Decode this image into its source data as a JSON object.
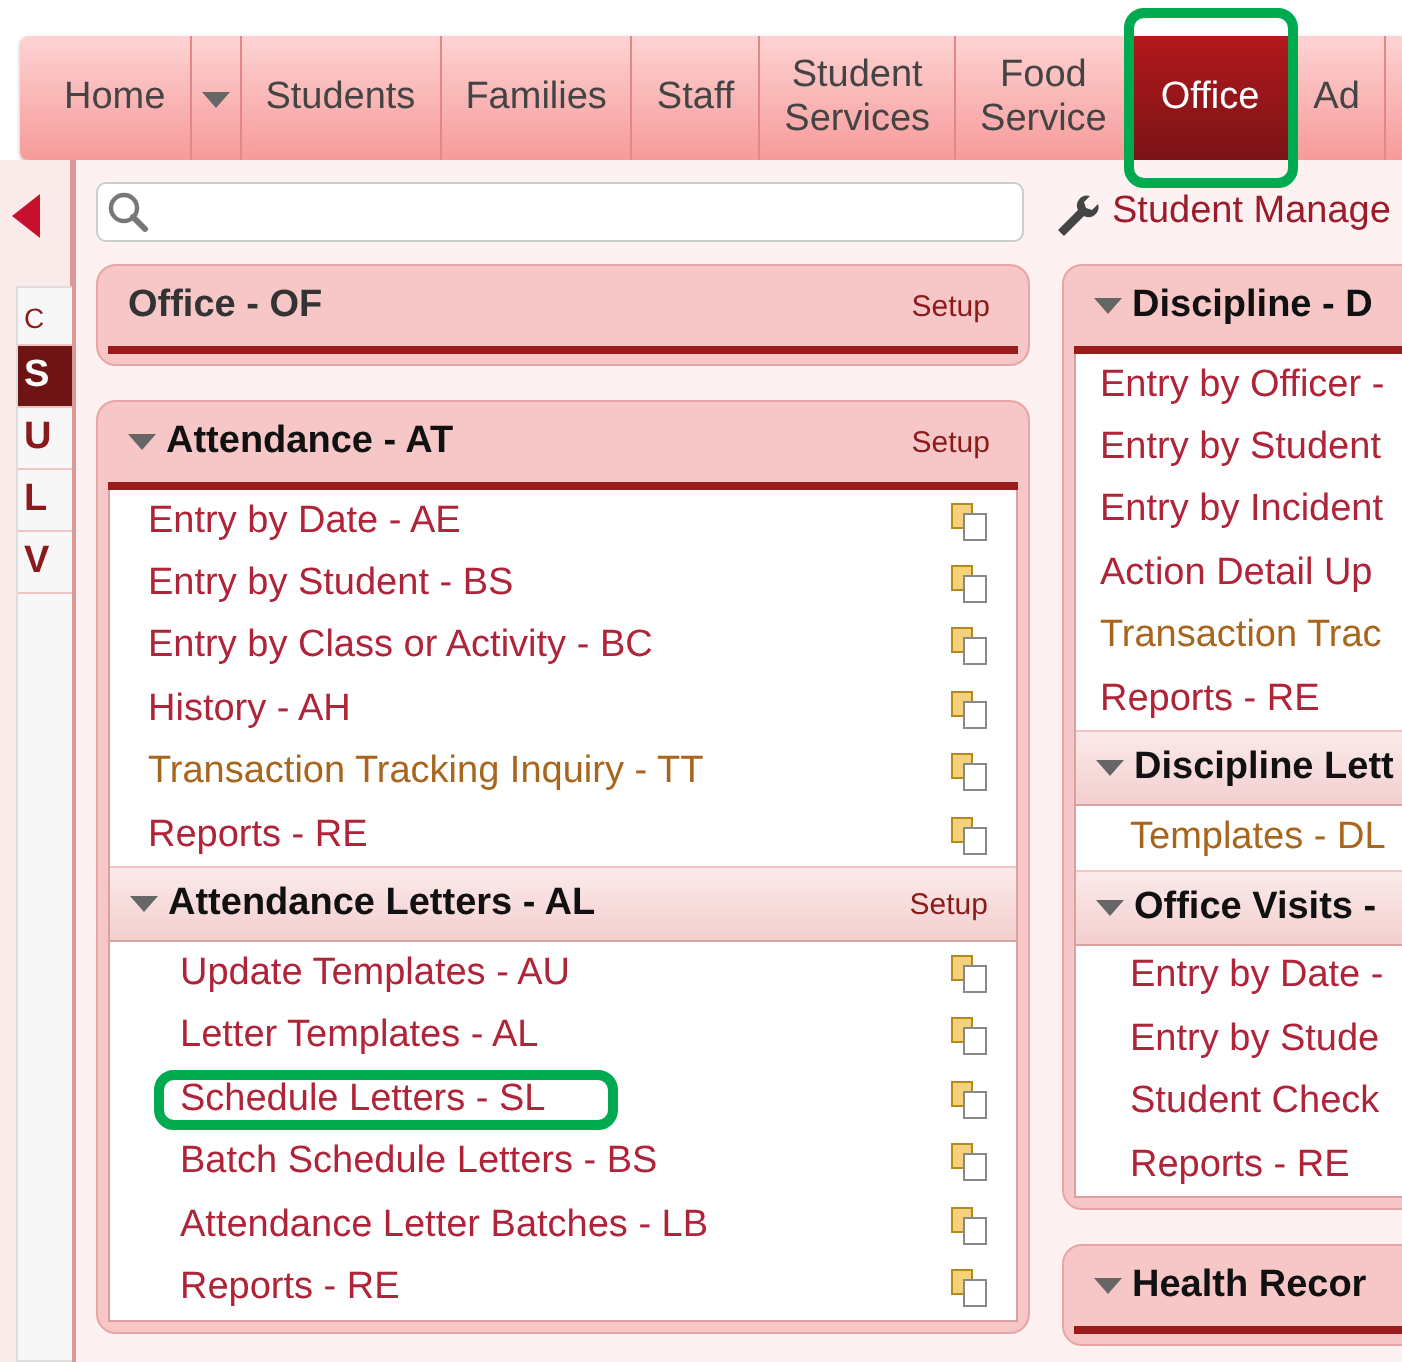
{
  "nav_tabs": [
    {
      "label": "Home",
      "selected": false,
      "highlighted": false
    },
    {
      "label": "Students",
      "selected": false,
      "highlighted": false
    },
    {
      "label": "Families",
      "selected": false,
      "highlighted": false
    },
    {
      "label": "Staff",
      "selected": false,
      "highlighted": false
    },
    {
      "label": "Student Services",
      "selected": false,
      "highlighted": false
    },
    {
      "label": "Food Service",
      "selected": false,
      "highlighted": false
    },
    {
      "label": "Office",
      "selected": true,
      "highlighted": true
    },
    {
      "label": "Ad",
      "selected": false,
      "highlighted": false
    }
  ],
  "sidebar": {
    "items": [
      {
        "label": "C",
        "selected": false
      },
      {
        "label": "S",
        "selected": true
      },
      {
        "label": "U",
        "selected": false
      },
      {
        "label": "L",
        "selected": false
      },
      {
        "label": "V",
        "selected": false
      }
    ]
  },
  "toolbar_link": "Student Manage",
  "columns": [
    {
      "cards": [
        {
          "title": "Office - OF",
          "setup": "Setup",
          "expandable": false
        },
        {
          "title": "Attendance - AT",
          "setup": "Setup",
          "expandable": true,
          "items": [
            {
              "label": "Entry by Date - AE",
              "visited": false,
              "highlighted": false
            },
            {
              "label": "Entry by Student - BS",
              "visited": false,
              "highlighted": false
            },
            {
              "label": "Entry by Class or Activity - BC",
              "visited": false,
              "highlighted": false
            },
            {
              "label": "History - AH",
              "visited": false,
              "highlighted": false
            },
            {
              "label": "Transaction Tracking Inquiry - TT",
              "visited": true,
              "highlighted": false
            },
            {
              "label": "Reports - RE",
              "visited": false,
              "highlighted": false
            }
          ],
          "subsections": [
            {
              "title": "Attendance Letters - AL",
              "setup": "Setup",
              "items": [
                {
                  "label": "Update Templates - AU",
                  "visited": false,
                  "highlighted": false
                },
                {
                  "label": "Letter Templates - AL",
                  "visited": false,
                  "highlighted": false
                },
                {
                  "label": "Schedule Letters - SL",
                  "visited": false,
                  "highlighted": true
                },
                {
                  "label": "Batch Schedule Letters - BS",
                  "visited": false,
                  "highlighted": false
                },
                {
                  "label": "Attendance Letter Batches - LB",
                  "visited": false,
                  "highlighted": false
                },
                {
                  "label": "Reports - RE",
                  "visited": false,
                  "highlighted": false
                }
              ]
            }
          ]
        }
      ]
    },
    {
      "cards": [
        {
          "title": "Discipline - D",
          "expandable": true,
          "items": [
            {
              "label": "Entry by Officer -",
              "visited": false,
              "highlighted": false
            },
            {
              "label": "Entry by Student",
              "visited": false,
              "highlighted": false
            },
            {
              "label": "Entry by Incident",
              "visited": false,
              "highlighted": false
            },
            {
              "label": "Action Detail Up",
              "visited": false,
              "highlighted": false
            },
            {
              "label": "Transaction Trac",
              "visited": true,
              "highlighted": false
            },
            {
              "label": "Reports - RE",
              "visited": false,
              "highlighted": false
            }
          ],
          "subsections": [
            {
              "title": "Discipline Lett",
              "items": [
                {
                  "label": "Templates - DL",
                  "visited": true,
                  "highlighted": false
                }
              ]
            },
            {
              "title": "Office Visits -",
              "items": [
                {
                  "label": "Entry by Date -",
                  "visited": false,
                  "highlighted": false
                },
                {
                  "label": "Entry by Stude",
                  "visited": false,
                  "highlighted": false
                },
                {
                  "label": "Student Check",
                  "visited": false,
                  "highlighted": false
                },
                {
                  "label": "Reports - RE",
                  "visited": false,
                  "highlighted": false
                }
              ]
            }
          ]
        },
        {
          "title": "Health Recor",
          "expandable": true
        }
      ]
    }
  ]
}
